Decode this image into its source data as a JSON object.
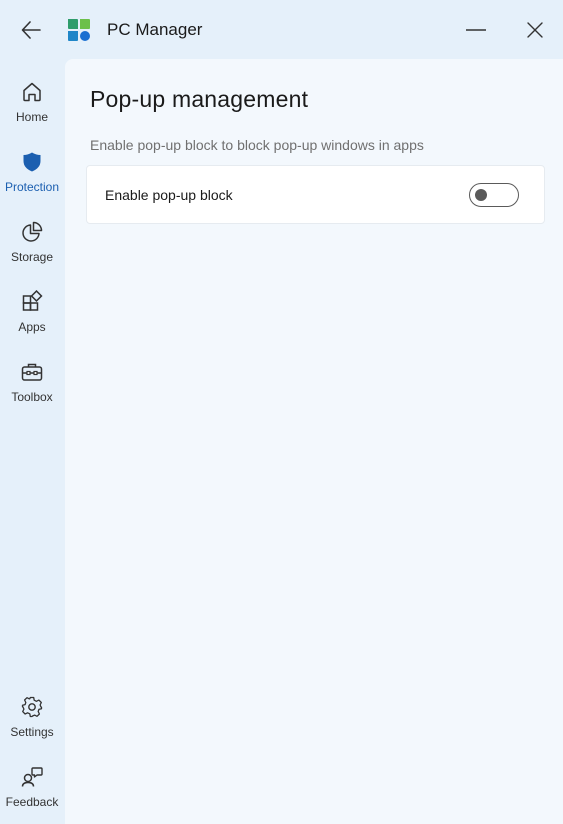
{
  "app": {
    "title": "PC Manager"
  },
  "sidebar": {
    "items": [
      {
        "label": "Home",
        "icon": "home-icon",
        "active": false
      },
      {
        "label": "Protection",
        "icon": "shield-icon",
        "active": true
      },
      {
        "label": "Storage",
        "icon": "pie-chart-icon",
        "active": false
      },
      {
        "label": "Apps",
        "icon": "apps-icon",
        "active": false
      },
      {
        "label": "Toolbox",
        "icon": "toolbox-icon",
        "active": false
      }
    ],
    "bottom_items": [
      {
        "label": "Settings",
        "icon": "gear-icon"
      },
      {
        "label": "Feedback",
        "icon": "feedback-icon"
      }
    ]
  },
  "main": {
    "title": "Pop-up management",
    "description": "Enable pop-up block to block pop-up windows in apps",
    "setting": {
      "label": "Enable pop-up block",
      "enabled": false
    }
  },
  "colors": {
    "accent": "#1b5fb0",
    "sidebar_bg": "#e5f0fa",
    "content_bg": "#f3f8fd"
  }
}
